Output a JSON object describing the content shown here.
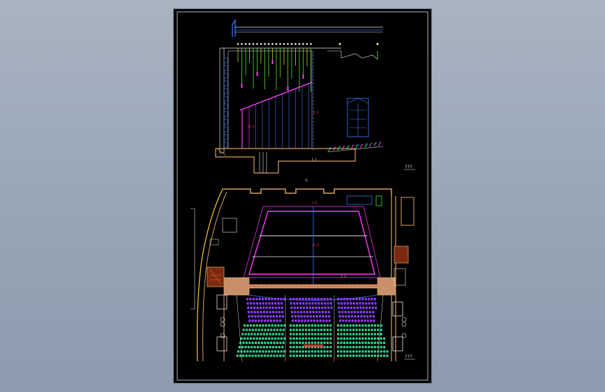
{
  "drawing": {
    "title_section": "???",
    "title_plan": "???",
    "centerline_mark": "CL",
    "section_centerline": "C L",
    "plan_centerline": "C L"
  },
  "colors": {
    "background": "#8fa0b4",
    "sheet": "#000000",
    "wall": "#d4a05a",
    "magenta": "#ff3cff",
    "seat_purple": "#8a3cff",
    "seat_green": "#33d68c",
    "line_white": "#e8e8e8",
    "line_blue": "#3c7dff",
    "rig_green": "#6cff3c",
    "red": "#ff2a2a"
  },
  "seating": {
    "purple_rows": 6,
    "green_rows": 8
  }
}
